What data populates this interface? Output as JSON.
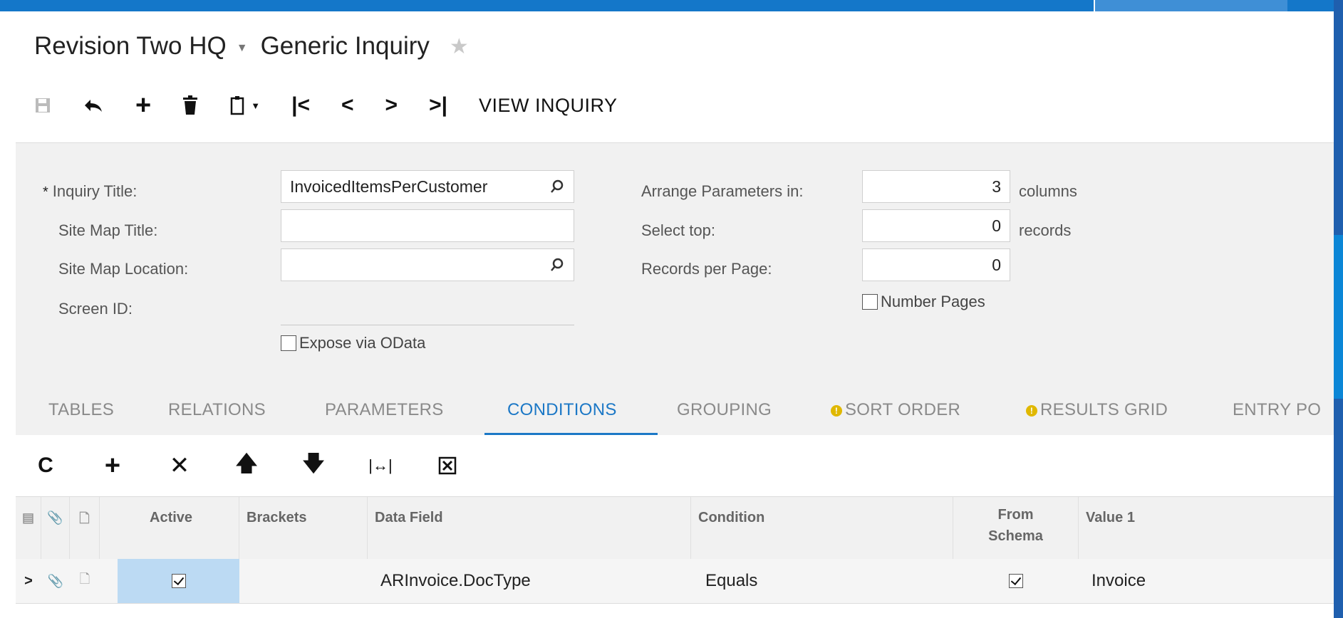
{
  "header": {
    "company": "Revision Two HQ",
    "screen_title": "Generic Inquiry"
  },
  "toolbar": {
    "view_inquiry_label": "VIEW INQUIRY"
  },
  "form": {
    "inquiry_title_label": "Inquiry Title:",
    "inquiry_title_value": "InvoicedItemsPerCustomer",
    "site_map_title_label": "Site Map Title:",
    "site_map_title_value": "",
    "site_map_location_label": "Site Map Location:",
    "site_map_location_value": "",
    "screen_id_label": "Screen ID:",
    "expose_odata_label": "Expose via OData",
    "arrange_params_label": "Arrange Parameters in:",
    "arrange_params_value": "3",
    "arrange_params_unit": "columns",
    "select_top_label": "Select top:",
    "select_top_value": "0",
    "select_top_unit": "records",
    "records_per_page_label": "Records per Page:",
    "records_per_page_value": "0",
    "number_pages_label": "Number Pages"
  },
  "tabs": [
    "TABLES",
    "RELATIONS",
    "PARAMETERS",
    "CONDITIONS",
    "GROUPING",
    "SORT ORDER",
    "RESULTS GRID",
    "ENTRY PO"
  ],
  "active_tab": "CONDITIONS",
  "grid": {
    "columns": [
      "Active",
      "Brackets",
      "Data Field",
      "Condition",
      "From Schema",
      "Value 1"
    ],
    "from_schema_line1": "From",
    "from_schema_line2": "Schema",
    "rows": [
      {
        "active": true,
        "brackets": "",
        "data_field": "ARInvoice.DocType",
        "condition": "Equals",
        "from_schema": true,
        "value1": "Invoice"
      }
    ]
  },
  "colors": {
    "accent": "#1c78c6",
    "topbar": "#1477c9",
    "warning": "#e0b800",
    "selected_cell": "#bcdaf3"
  }
}
